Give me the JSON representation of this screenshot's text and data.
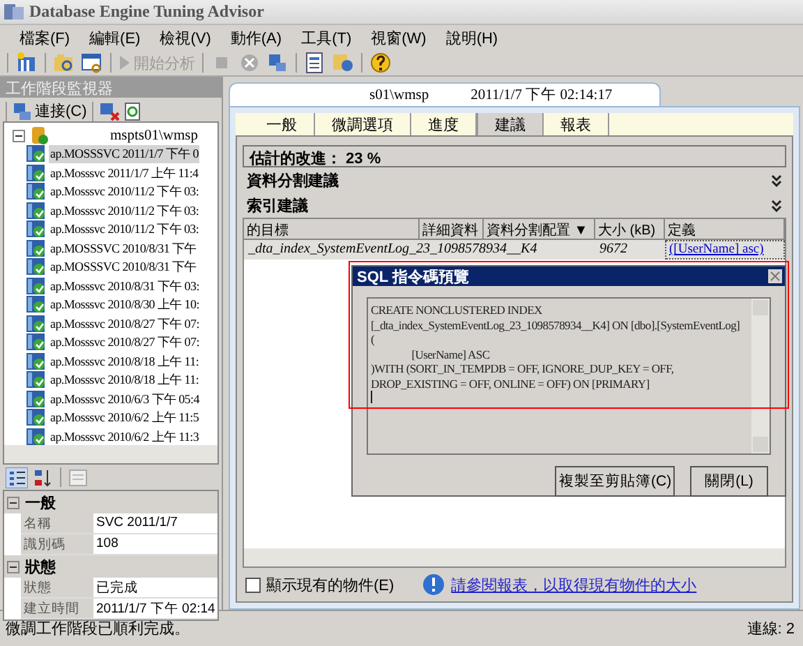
{
  "window": {
    "title": "Database Engine Tuning Advisor"
  },
  "menu": [
    "檔案(F)",
    "編輯(E)",
    "檢視(V)",
    "動作(A)",
    "工具(T)",
    "視窗(W)",
    "說明(H)"
  ],
  "toolbar": {
    "start_button": {
      "label": "開始分析",
      "disabled": true
    }
  },
  "session_monitor": {
    "title": "工作階段監視器",
    "connect_button": "連接(C)",
    "root": "mspts01\\wmsp",
    "sessions": [
      {
        "label": "ap.MOSSSVC 2011/1/7 下午 0",
        "selected": true
      },
      {
        "label": "ap.Mosssvc 2011/1/7 上午 11:4",
        "selected": false
      },
      {
        "label": "ap.Mosssvc 2010/11/2 下午 03:",
        "selected": false
      },
      {
        "label": "ap.Mosssvc 2010/11/2 下午 03:",
        "selected": false
      },
      {
        "label": "ap.Mosssvc 2010/11/2 下午 03:",
        "selected": false
      },
      {
        "label": "ap.MOSSSVC 2010/8/31 下午",
        "selected": false
      },
      {
        "label": "ap.MOSSSVC 2010/8/31 下午",
        "selected": false
      },
      {
        "label": "ap.Mosssvc 2010/8/31 下午 03:",
        "selected": false
      },
      {
        "label": "ap.Mosssvc 2010/8/30 上午 10:",
        "selected": false
      },
      {
        "label": "ap.Mosssvc 2010/8/27 下午 07:",
        "selected": false
      },
      {
        "label": "ap.Mosssvc 2010/8/27 下午 07:",
        "selected": false
      },
      {
        "label": "ap.Mosssvc 2010/8/18 上午 11:",
        "selected": false
      },
      {
        "label": "ap.Mosssvc 2010/8/18 上午 11:",
        "selected": false
      },
      {
        "label": "ap.Mosssvc 2010/6/3 下午 05:4",
        "selected": false
      },
      {
        "label": "ap.Mosssvc 2010/6/2 上午 11:5",
        "selected": false
      },
      {
        "label": "ap.Mosssvc 2010/6/2 上午 11:3",
        "selected": false
      }
    ],
    "properties": [
      {
        "group": "一般",
        "rows": [
          {
            "name": "名稱",
            "value": "SVC 2011/1/7"
          },
          {
            "name": "識別碼",
            "value": "108"
          }
        ]
      },
      {
        "group": "狀態",
        "rows": [
          {
            "name": "狀態",
            "value": "已完成"
          },
          {
            "name": "建立時間",
            "value": "2011/1/7 下午 02:14"
          }
        ]
      }
    ]
  },
  "session": {
    "title_parts": [
      "s01\\wmsp",
      "2011/1/7 下午 02:14:17"
    ],
    "tabs": [
      {
        "label": "一般",
        "selected": false
      },
      {
        "label": "微調選項",
        "selected": false
      },
      {
        "label": "進度",
        "selected": false
      },
      {
        "label": "建議",
        "selected": true
      },
      {
        "label": "報表",
        "selected": false
      }
    ],
    "improvement": "估計的改進：  23 %",
    "sections": [
      "資料分割建議",
      "索引建議"
    ],
    "table": {
      "columns": [
        "的目標",
        "詳細資料",
        "資料分割配置 ▼",
        "大小 (kB)",
        "定義"
      ],
      "rows": [
        {
          "target": "_dta_index_SystemEventLog_23_1098578934__K4",
          "size": "9672",
          "definition": "([UserName] asc)"
        }
      ]
    },
    "show_existing": {
      "label": "顯示現有的物件(E)",
      "checked": false
    },
    "report_link": "請參閱報表，以取得現有物件的大小"
  },
  "dialog": {
    "title": "SQL 指令碼預覽",
    "script": [
      "CREATE NONCLUSTERED INDEX",
      "[_dta_index_SystemEventLog_23_1098578934__K4] ON [dbo].[SystemEventLog]",
      "(",
      "                [UserName] ASC",
      ")WITH (SORT_IN_TEMPDB = OFF, IGNORE_DUP_KEY = OFF,",
      "DROP_EXISTING = OFF, ONLINE = OFF) ON [PRIMARY]"
    ],
    "buttons": [
      "複製至剪貼簿(C)",
      "關閉(L)"
    ]
  },
  "status_bar": {
    "message": "微調工作階段已順利完成。",
    "connections": "連線: 2"
  }
}
